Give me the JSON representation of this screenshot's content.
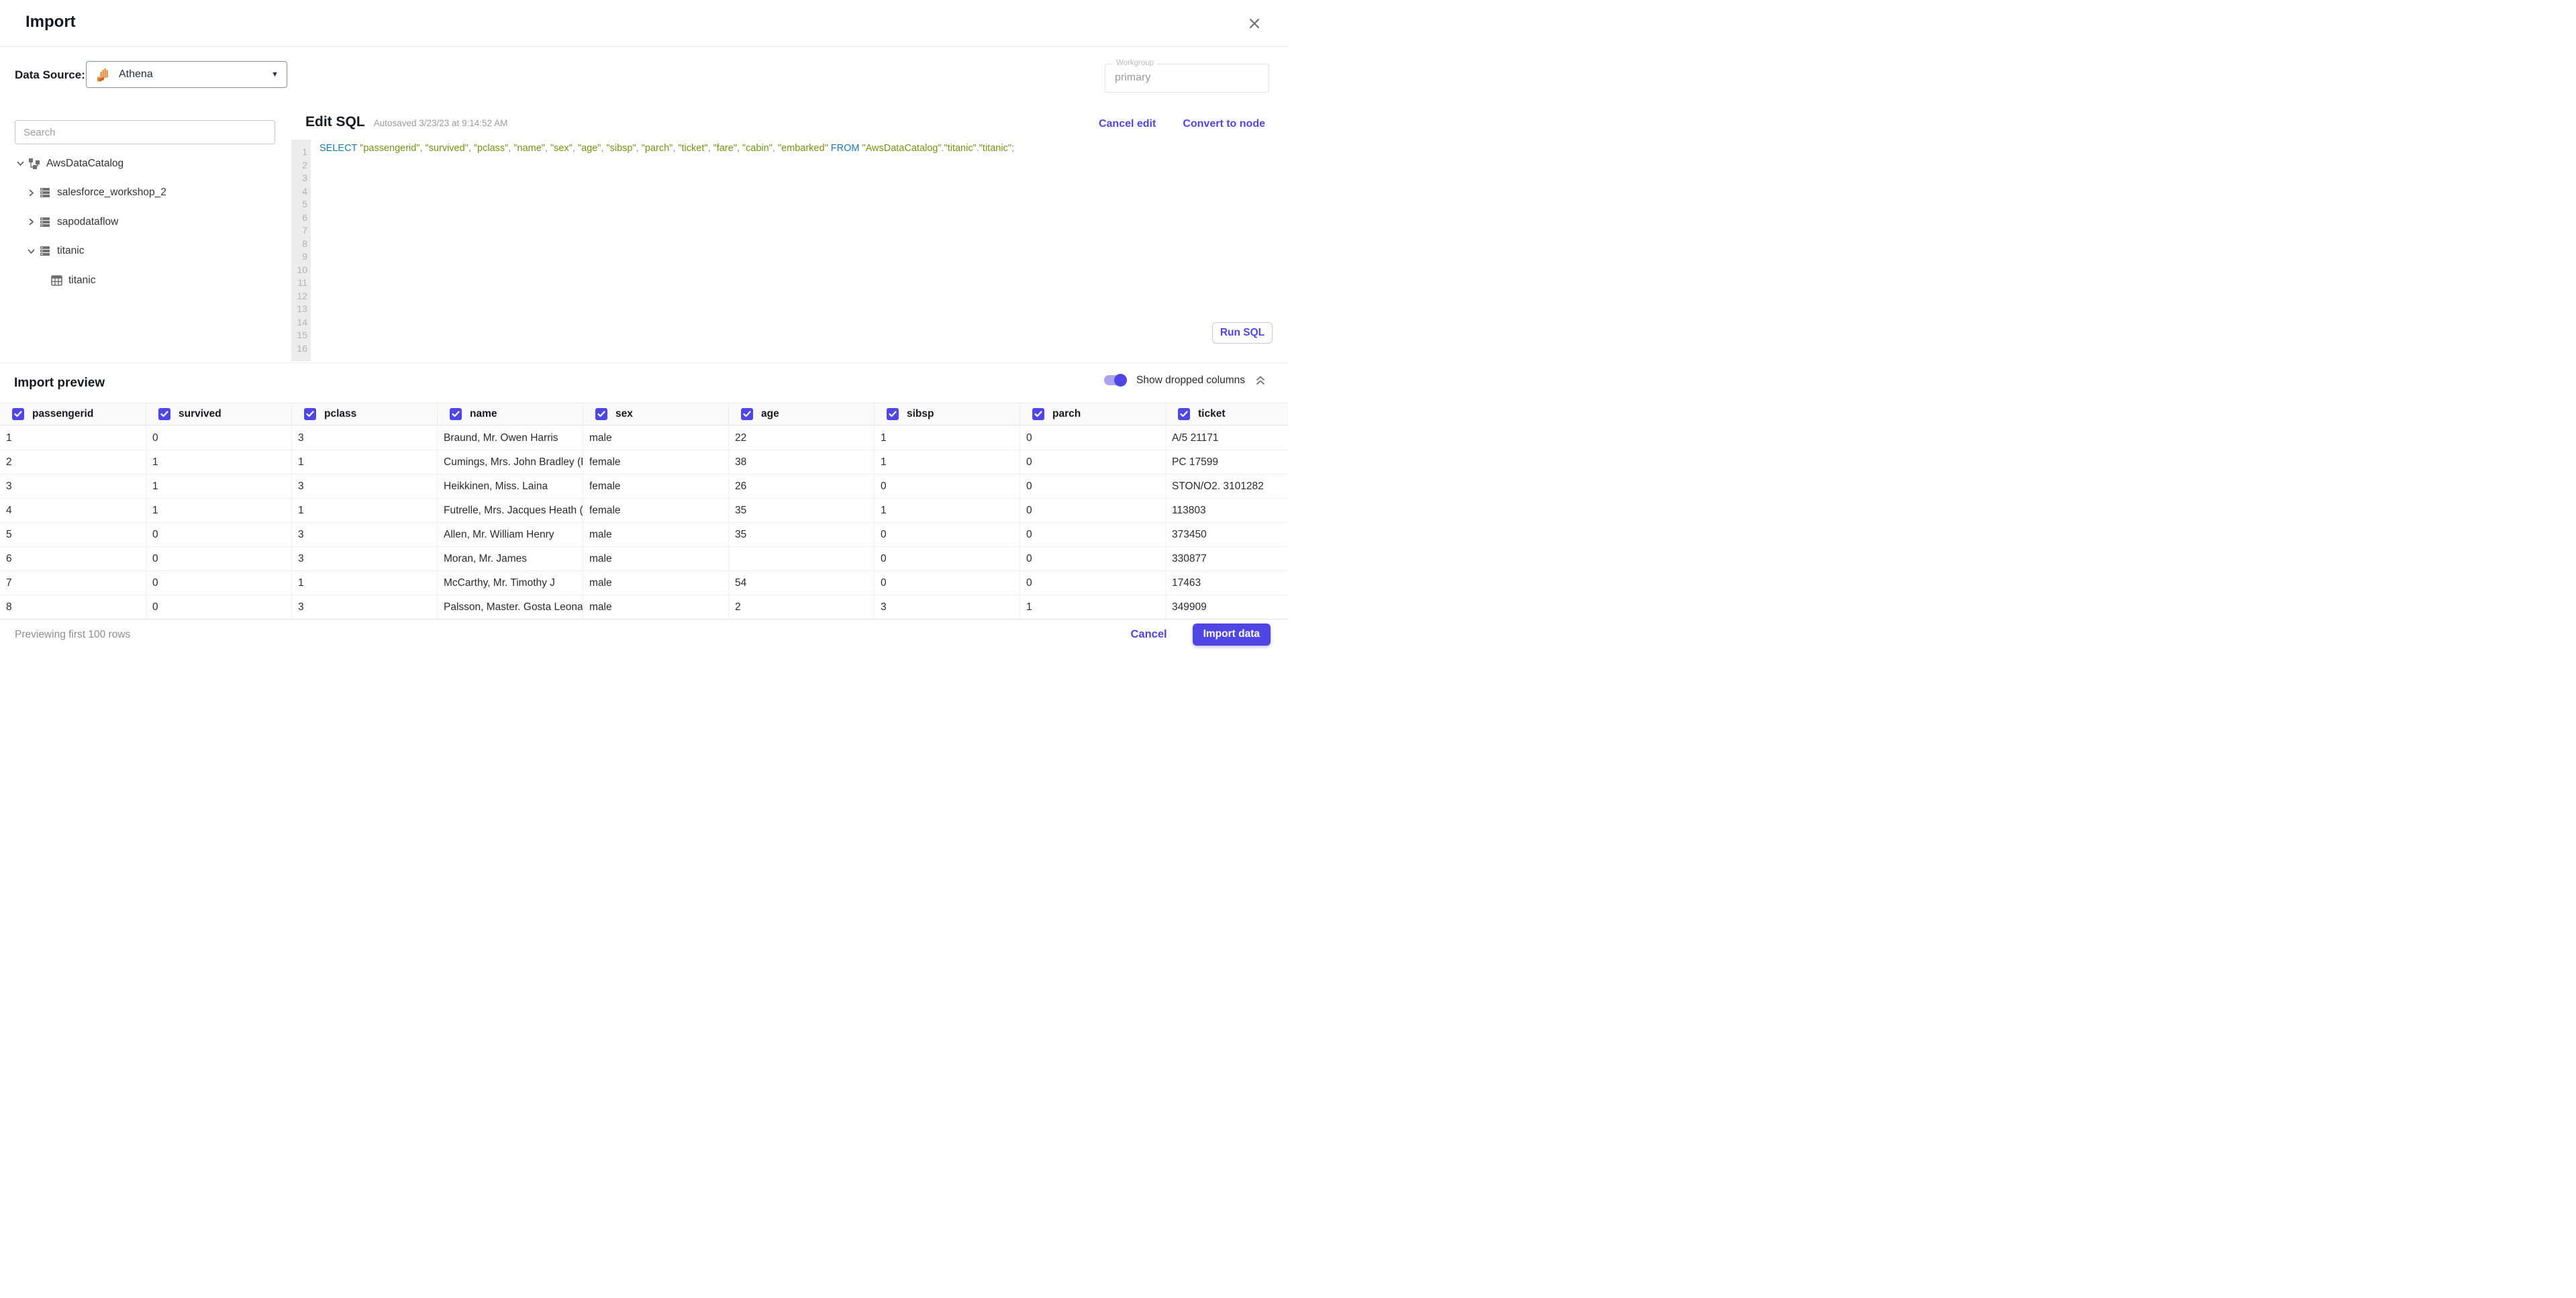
{
  "header": {
    "title": "Import"
  },
  "datasource": {
    "label": "Data Source:",
    "selected": "Athena",
    "athena_icon": "athena-logo-icon",
    "workgroup_label": "Workgroup",
    "workgroup_value": "primary"
  },
  "sidebar": {
    "search_placeholder": "Search",
    "tree": [
      {
        "label": "AwsDataCatalog",
        "icon": "catalog-icon",
        "chevron": "down",
        "depth": 0
      },
      {
        "label": "salesforce_workshop_2",
        "icon": "database-icon",
        "chevron": "right",
        "depth": 1
      },
      {
        "label": "sapodataflow",
        "icon": "database-icon",
        "chevron": "right",
        "depth": 1
      },
      {
        "label": "titanic",
        "icon": "database-icon",
        "chevron": "down",
        "depth": 1
      },
      {
        "label": "titanic",
        "icon": "table-icon",
        "chevron": "none",
        "depth": 2
      }
    ]
  },
  "editor": {
    "title": "Edit SQL",
    "autosaved": "Autosaved 3/23/23 at 9:14:52 AM",
    "cancel_edit": "Cancel edit",
    "convert_to_node": "Convert to node",
    "run_sql": "Run SQL",
    "line_count": 16,
    "sql_tokens": [
      {
        "t": "kw",
        "v": "SELECT"
      },
      {
        "t": "pl",
        "v": " "
      },
      {
        "t": "str",
        "v": "\"passengerid\""
      },
      {
        "t": "pl",
        "v": ", "
      },
      {
        "t": "str",
        "v": "\"survived\""
      },
      {
        "t": "pl",
        "v": ", "
      },
      {
        "t": "str",
        "v": "\"pclass\""
      },
      {
        "t": "pl",
        "v": ", "
      },
      {
        "t": "str",
        "v": "\"name\""
      },
      {
        "t": "pl",
        "v": ", "
      },
      {
        "t": "str",
        "v": "\"sex\""
      },
      {
        "t": "pl",
        "v": ", "
      },
      {
        "t": "str",
        "v": "\"age\""
      },
      {
        "t": "pl",
        "v": ", "
      },
      {
        "t": "str",
        "v": "\"sibsp\""
      },
      {
        "t": "pl",
        "v": ", "
      },
      {
        "t": "str",
        "v": "\"parch\""
      },
      {
        "t": "pl",
        "v": ", "
      },
      {
        "t": "str",
        "v": "\"ticket\""
      },
      {
        "t": "pl",
        "v": ", "
      },
      {
        "t": "str",
        "v": "\"fare\""
      },
      {
        "t": "pl",
        "v": ", "
      },
      {
        "t": "str",
        "v": "\"cabin\""
      },
      {
        "t": "pl",
        "v": ", "
      },
      {
        "t": "str",
        "v": "\"embarked\""
      },
      {
        "t": "pl",
        "v": " "
      },
      {
        "t": "kw",
        "v": "FROM"
      },
      {
        "t": "pl",
        "v": " "
      },
      {
        "t": "str",
        "v": "\"AwsDataCatalog\""
      },
      {
        "t": "pl",
        "v": "."
      },
      {
        "t": "str",
        "v": "\"titanic\""
      },
      {
        "t": "pl",
        "v": "."
      },
      {
        "t": "str",
        "v": "\"titanic\""
      },
      {
        "t": "pl",
        "v": ";"
      }
    ]
  },
  "preview": {
    "title": "Import preview",
    "toggle_label": "Show dropped columns",
    "toggle_on": true,
    "collapse_icon": "double-chevron-up-icon",
    "columns": [
      "passengerid",
      "survived",
      "pclass",
      "name",
      "sex",
      "age",
      "sibsp",
      "parch",
      "ticket"
    ],
    "columns_checked": [
      true,
      true,
      true,
      true,
      true,
      true,
      true,
      true,
      true
    ],
    "rows": [
      [
        "1",
        "0",
        "3",
        "Braund, Mr. Owen Harris",
        "male",
        "22",
        "1",
        "0",
        "A/5 21171"
      ],
      [
        "2",
        "1",
        "1",
        "Cumings, Mrs. John Bradley (Florenc",
        "female",
        "38",
        "1",
        "0",
        "PC 17599"
      ],
      [
        "3",
        "1",
        "3",
        "Heikkinen, Miss. Laina",
        "female",
        "26",
        "0",
        "0",
        "STON/O2. 3101282"
      ],
      [
        "4",
        "1",
        "1",
        "Futrelle, Mrs. Jacques Heath (Lily Ma",
        "female",
        "35",
        "1",
        "0",
        "113803"
      ],
      [
        "5",
        "0",
        "3",
        "Allen, Mr. William Henry",
        "male",
        "35",
        "0",
        "0",
        "373450"
      ],
      [
        "6",
        "0",
        "3",
        "Moran, Mr. James",
        "male",
        "",
        "0",
        "0",
        "330877"
      ],
      [
        "7",
        "0",
        "1",
        "McCarthy, Mr. Timothy J",
        "male",
        "54",
        "0",
        "0",
        "17463"
      ],
      [
        "8",
        "0",
        "3",
        "Palsson, Master. Gosta Leonard",
        "male",
        "2",
        "3",
        "1",
        "349909"
      ]
    ]
  },
  "footer": {
    "status": "Previewing first 100 rows",
    "cancel": "Cancel",
    "import": "Import data"
  },
  "colors": {
    "accent": "#4f46e5",
    "sql_keyword": "#1878b9",
    "sql_string": "#71960b",
    "sql_punct": "#8a8a8a",
    "athena_orange": "#e8842b",
    "gutter_bg": "#ececec",
    "table_header_bg": "#fafafa"
  }
}
